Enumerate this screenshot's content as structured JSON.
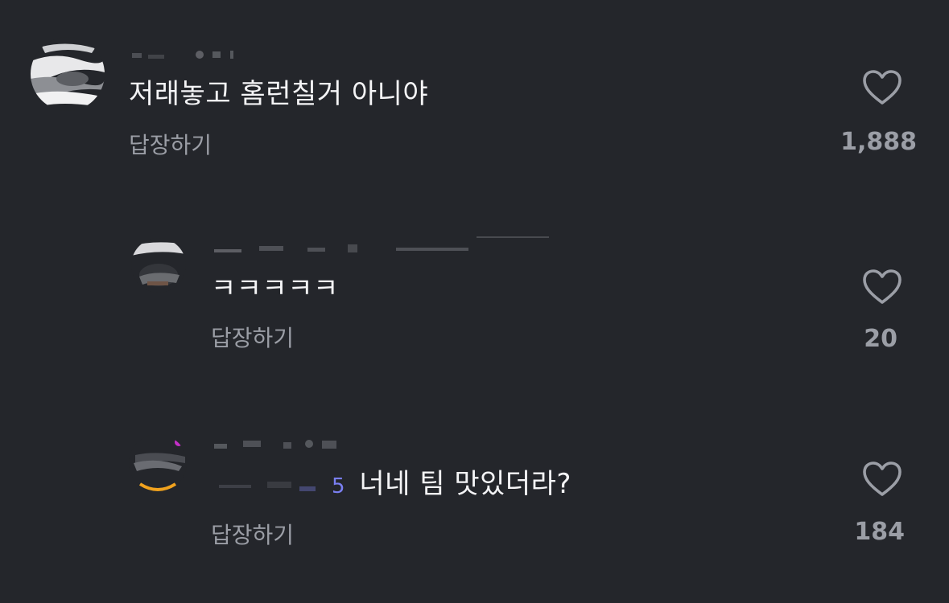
{
  "comments": [
    {
      "text": "저래놓고 홈런칠거 아니야",
      "reply_label": "답장하기",
      "like_count": "1,888",
      "like_icon": "heart-outline-icon"
    },
    {
      "text": "ㅋㅋㅋㅋㅋ",
      "reply_label": "답장하기",
      "like_count": "20",
      "like_icon": "heart-outline-icon"
    },
    {
      "mention_tail": "5",
      "text": "너네 팀 맛있더라?",
      "reply_label": "답장하기",
      "like_count": "184",
      "like_icon": "heart-outline-icon"
    }
  ],
  "colors": {
    "background": "#24262b",
    "text": "#f4f4f6",
    "secondary": "#9b9ea6",
    "mention": "#7a7ff2"
  }
}
